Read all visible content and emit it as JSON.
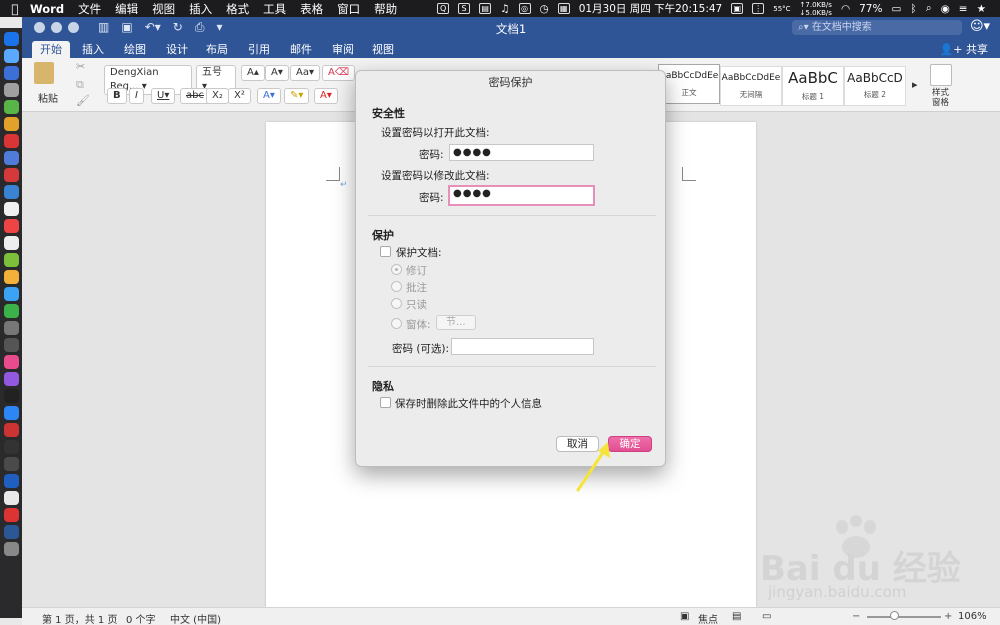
{
  "menubar": {
    "app": "Word",
    "items": [
      "文件",
      "编辑",
      "视图",
      "插入",
      "格式",
      "工具",
      "表格",
      "窗口",
      "帮助"
    ],
    "temp": "55°C",
    "net_up": "↑7.0KB/s",
    "net_down": "↓5.0KB/s",
    "datetime": "01月30日 周四 下午20:15:47",
    "battery": "77%"
  },
  "titlebar": {
    "title": "文档1",
    "search_placeholder": "在文档中搜索"
  },
  "tabs": [
    "开始",
    "插入",
    "绘图",
    "设计",
    "布局",
    "引用",
    "邮件",
    "审阅",
    "视图"
  ],
  "share_label": "共享",
  "ribbon": {
    "paste_label": "粘贴",
    "font_name": "DengXian Reg...",
    "font_size": "五号",
    "styles": [
      {
        "sample": "AaBbCcDdEe",
        "name": "正文"
      },
      {
        "sample": "AaBbCcDdEe",
        "name": "无间隔"
      },
      {
        "sample": "AaBbC",
        "name": "标题 1"
      },
      {
        "sample": "AaBbCcD",
        "name": "标题 2"
      }
    ],
    "styles_pane_label": "样式\n窗格",
    "styles_pane_l1": "样式",
    "styles_pane_l2": "窗格"
  },
  "dialog": {
    "title": "密码保护",
    "security_heading": "安全性",
    "open_prompt": "设置密码以打开此文档:",
    "open_password_label": "密码:",
    "open_password_value": "●●●●",
    "modify_prompt": "设置密码以修改此文档:",
    "modify_password_label": "密码:",
    "modify_password_value": "●●●●",
    "protection_heading": "保护",
    "protect_doc_label": "保护文档:",
    "options": [
      "修订",
      "批注",
      "只读",
      "窗体:"
    ],
    "section_button": "节...",
    "optional_password_label": "密码 (可选):",
    "privacy_heading": "隐私",
    "privacy_label": "保存时删除此文件中的个人信息",
    "cancel_label": "取消",
    "ok_label": "确定"
  },
  "statusbar": {
    "page": "第 1 页，共 1 页",
    "words": "0 个字",
    "language": "中文 (中国)",
    "focus": "焦点",
    "zoom": "106%"
  },
  "watermark": {
    "logo": "Bai du 经验",
    "url": "jingyan.baidu.com"
  },
  "colors": {
    "word_blue": "#2f5597",
    "ok_pink": "#e24f92",
    "arrow_yellow": "#f5e43a"
  }
}
